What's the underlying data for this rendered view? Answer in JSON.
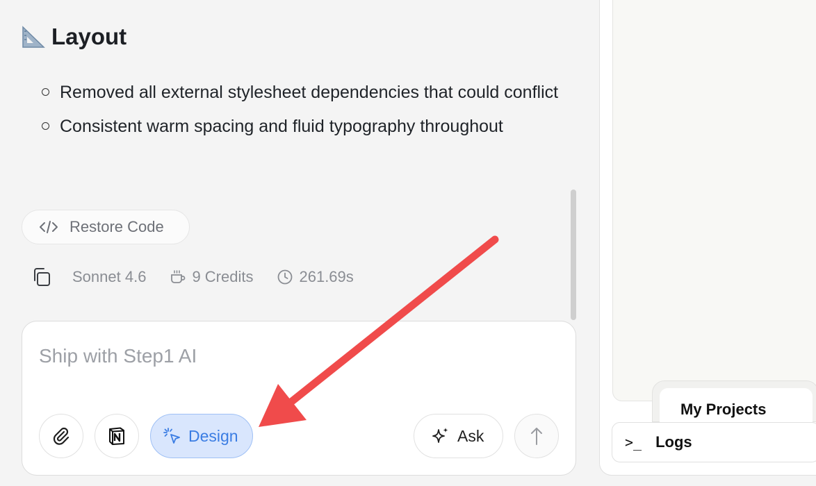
{
  "chat": {
    "section_title": "Layout",
    "section_icon": "triangle-ruler-icon",
    "bullets": [
      "Removed all external stylesheet dependencies that could conflict",
      "Consistent warm spacing and fluid typography throughout"
    ],
    "restore_label": "Restore Code",
    "meta": {
      "model": "Sonnet 4.6",
      "credits": "9 Credits",
      "duration": "261.69s"
    }
  },
  "composer": {
    "placeholder": "Ship with Step1 AI",
    "design_label": "Design",
    "ask_label": "Ask"
  },
  "right_panel": {
    "projects_tab_label": "My Projects",
    "logs_label": "Logs",
    "logs_prompt": ">_"
  },
  "colors": {
    "design_accent": "#3b7de3",
    "annotation_arrow": "#f04b4b"
  }
}
